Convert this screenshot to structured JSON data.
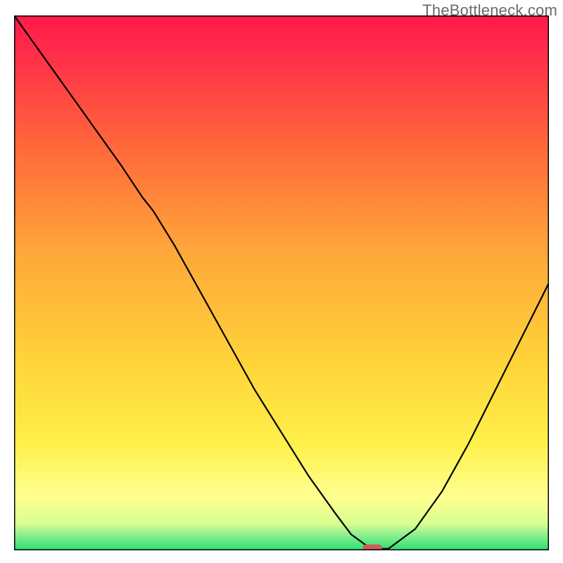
{
  "watermark": "TheBottleneck.com",
  "chart_data": {
    "type": "line",
    "title": "",
    "xlabel": "",
    "ylabel": "",
    "xlim": [
      0,
      100
    ],
    "ylim": [
      0,
      100
    ],
    "grid": false,
    "legend": false,
    "background_gradient": {
      "top_color": "#ff1a4a",
      "mid_color": "#ffd400",
      "near_bottom_color": "#ffff80",
      "bottom_color": "#28e070"
    },
    "series": [
      {
        "name": "bottleneck-curve",
        "color": "#000000",
        "x": [
          0,
          5,
          10,
          15,
          20,
          24,
          26,
          30,
          35,
          40,
          45,
          50,
          55,
          60,
          63,
          66,
          68,
          70,
          75,
          80,
          85,
          90,
          95,
          100
        ],
        "y": [
          100,
          93,
          86,
          79,
          72,
          66,
          63.5,
          57,
          48,
          39,
          30,
          22,
          14,
          7,
          3,
          0.8,
          0.3,
          0.3,
          4,
          11,
          20,
          30,
          40,
          50
        ]
      }
    ],
    "marker": {
      "name": "optimal-pill",
      "x": 67,
      "y": 0.4,
      "width_pct": 3.6,
      "height_pct": 1.4,
      "color": "#d05a5a"
    },
    "frame": {
      "stroke": "#000000",
      "stroke_width": 3
    }
  }
}
